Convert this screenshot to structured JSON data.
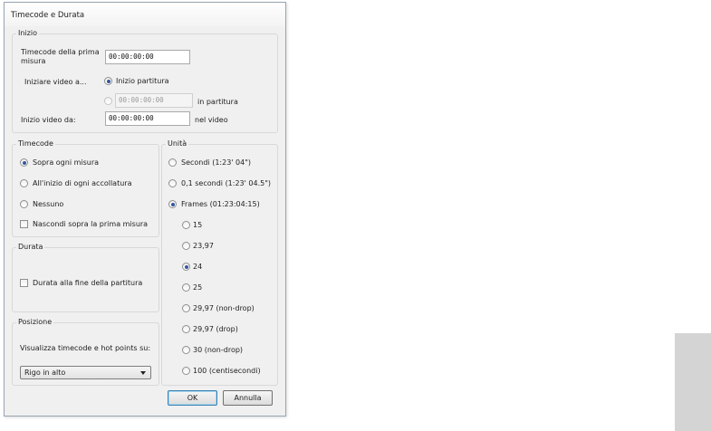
{
  "window": {
    "title": "Timecode e Durata"
  },
  "inizio": {
    "legend": "Inizio",
    "first_bar_label": "Timecode della prima misura",
    "first_bar_value": "00:00:00:00",
    "start_video_label": "Iniziare video a...",
    "option_score_start": "Inizio partitura",
    "option_time_value": "00:00:00:00",
    "option_time_suffix": "in partitura",
    "video_start_label": "Inizio video da:",
    "video_start_value": "00:00:00:00",
    "video_start_suffix": "nel video"
  },
  "timecode": {
    "legend": "Timecode",
    "options": [
      "Sopra ogni misura",
      "All'inizio di ogni accollatura",
      "Nessuno"
    ],
    "selected": 0,
    "hide_first_bar": "Nascondi sopra la prima misura"
  },
  "durata": {
    "legend": "Durata",
    "end_of_score": "Durata alla fine della partitura"
  },
  "posizione": {
    "legend": "Posizione",
    "label": "Visualizza timecode e hot points su:",
    "select_value": "Rigo in alto"
  },
  "unita": {
    "legend": "Unità",
    "options": [
      "Secondi (1:23' 04\")",
      "0,1 secondi (1:23' 04.5\")",
      "Frames (01:23:04:15)"
    ],
    "selected": 2,
    "frame_rates": [
      "15",
      "23,97",
      "24",
      "25",
      "29,97 (non-drop)",
      "29,97 (drop)",
      "30 (non-drop)",
      "100 (centisecondi)"
    ],
    "frame_selected": 2
  },
  "buttons": {
    "ok": "OK",
    "cancel": "Annulla"
  }
}
